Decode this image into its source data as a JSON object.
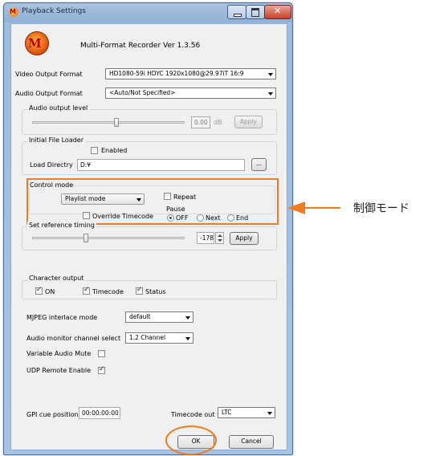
{
  "window": {
    "title": "Playback Settings",
    "app_icon_letter": "M"
  },
  "header": {
    "logo_letter": "M",
    "app_name": "Multi-Format Recorder  Ver 1.3.56"
  },
  "video_output": {
    "label": "Video Output Format",
    "value": "HD1080-59i HDYC 1920x1080@29.97iT 16:9"
  },
  "audio_output": {
    "label": "Audio Output Format",
    "value": "<Auto/Not Specified>"
  },
  "audio_level": {
    "title": "Audio output level",
    "value": "0.00",
    "unit": "dB",
    "apply_label": "Apply",
    "slider_level": 0.55
  },
  "file_loader": {
    "title": "Initial File Loader",
    "enabled_label": "Enabled",
    "enabled": false,
    "dir_label": "Load Directry",
    "dir_value": "D:¥",
    "browse_label": "..."
  },
  "control_mode": {
    "title": "Control mode",
    "mode_value": "Playlist mode",
    "repeat_label": "Repeat",
    "repeat": false,
    "override_label": "Override Timecode",
    "override": false,
    "pause_label": "Pause",
    "pause_options": [
      "OFF",
      "Next",
      "End"
    ],
    "pause_selected": "OFF"
  },
  "reference_timing": {
    "title": "Set reference timing",
    "value": "-178",
    "apply_label": "Apply",
    "slider_level": 0.35
  },
  "character_output": {
    "title": "Character output",
    "on_label": "ON",
    "timecode_label": "Timecode",
    "status_label": "Status",
    "on": true,
    "timecode": true,
    "status": true
  },
  "mjpeg": {
    "label": "MJPEG interlace mode",
    "value": "default"
  },
  "audio_monitor": {
    "label": "Audio monitor channel select",
    "value": "1,2 Channel"
  },
  "variable_mute": {
    "label": "Variable Audio Mute",
    "checked": false
  },
  "udp_remote": {
    "label": "UDP Remote Enable",
    "checked": true
  },
  "gpi": {
    "label": "GPI cue position",
    "value": "00:00:00:00"
  },
  "timecode_out": {
    "label": "Timecode out",
    "value": "LTC"
  },
  "footer": {
    "ok_label": "OK",
    "cancel_label": "Cancel"
  },
  "annotation": {
    "text": "制御モード",
    "color": "#f07c1d"
  }
}
